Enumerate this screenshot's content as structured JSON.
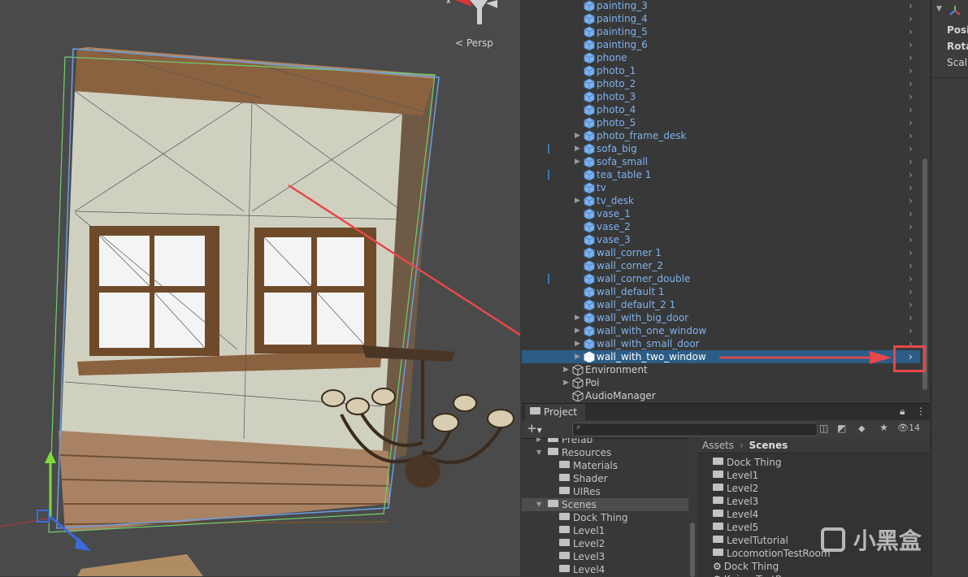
{
  "scene": {
    "persp_label": "Persp",
    "gizmo_axis_label": "x"
  },
  "hierarchy": {
    "items": [
      {
        "label": "painting_3",
        "kind": "cube",
        "arrow": false
      },
      {
        "label": "painting_4",
        "kind": "cube",
        "arrow": false
      },
      {
        "label": "painting_5",
        "kind": "cube",
        "arrow": false
      },
      {
        "label": "painting_6",
        "kind": "cube",
        "arrow": false
      },
      {
        "label": "phone",
        "kind": "cube",
        "arrow": false
      },
      {
        "label": "photo_1",
        "kind": "cube",
        "arrow": false
      },
      {
        "label": "photo_2",
        "kind": "cube",
        "arrow": false
      },
      {
        "label": "photo_3",
        "kind": "cube",
        "arrow": false
      },
      {
        "label": "photo_4",
        "kind": "cube",
        "arrow": false
      },
      {
        "label": "photo_5",
        "kind": "cube",
        "arrow": false
      },
      {
        "label": "photo_frame_desk",
        "kind": "cube",
        "arrow": true
      },
      {
        "label": "sofa_big",
        "kind": "cube",
        "arrow": true
      },
      {
        "label": "sofa_small",
        "kind": "cube",
        "arrow": true
      },
      {
        "label": "tea_table 1",
        "kind": "cube",
        "arrow": false
      },
      {
        "label": "tv",
        "kind": "cube",
        "arrow": false
      },
      {
        "label": "tv_desk",
        "kind": "cube",
        "arrow": true
      },
      {
        "label": "vase_1",
        "kind": "cube",
        "arrow": false
      },
      {
        "label": "vase_2",
        "kind": "cube",
        "arrow": false
      },
      {
        "label": "vase_3",
        "kind": "cube",
        "arrow": false
      },
      {
        "label": "wall_corner 1",
        "kind": "cube",
        "arrow": false
      },
      {
        "label": "wall_corner_2",
        "kind": "cube",
        "arrow": false
      },
      {
        "label": "wall_corner_double",
        "kind": "cube",
        "arrow": false
      },
      {
        "label": "wall_default 1",
        "kind": "cube",
        "arrow": false
      },
      {
        "label": "wall_default_2 1",
        "kind": "cube",
        "arrow": false
      },
      {
        "label": "wall_with_big_door",
        "kind": "cube",
        "arrow": true
      },
      {
        "label": "wall_with_one_window",
        "kind": "cube",
        "arrow": true
      },
      {
        "label": "wall_with_small_door",
        "kind": "cube",
        "arrow": true
      },
      {
        "label": "wall_with_two_window",
        "kind": "cube",
        "arrow": true,
        "selected": true
      },
      {
        "label": "Environment",
        "kind": "object",
        "arrow": true,
        "indent": -1
      },
      {
        "label": "Poi",
        "kind": "object",
        "arrow": true,
        "indent": -1
      },
      {
        "label": "AudioManager",
        "kind": "object",
        "arrow": false,
        "indent": -1
      }
    ]
  },
  "inspector": {
    "position_label": "Posit",
    "rotation_label": "Rota",
    "scale_label": "Scal"
  },
  "project": {
    "tab_label": "Project",
    "hidden_count": "14",
    "breadcrumb": {
      "root": "Assets",
      "current": "Scenes"
    },
    "tree": [
      {
        "label": "Prefab",
        "indent": 1,
        "open": false,
        "partial": true
      },
      {
        "label": "Resources",
        "indent": 1,
        "open": true
      },
      {
        "label": "Materials",
        "indent": 2
      },
      {
        "label": "Shader",
        "indent": 2
      },
      {
        "label": "UIRes",
        "indent": 2
      },
      {
        "label": "Scenes",
        "indent": 1,
        "open": true,
        "selected": true
      },
      {
        "label": "Dock Thing",
        "indent": 2
      },
      {
        "label": "Level1",
        "indent": 2
      },
      {
        "label": "Level2",
        "indent": 2
      },
      {
        "label": "Level3",
        "indent": 2
      },
      {
        "label": "Level4",
        "indent": 2
      }
    ],
    "contents": [
      {
        "label": "Dock Thing",
        "kind": "folder"
      },
      {
        "label": "Level1",
        "kind": "folder"
      },
      {
        "label": "Level2",
        "kind": "folder"
      },
      {
        "label": "Level3",
        "kind": "folder"
      },
      {
        "label": "Level4",
        "kind": "folder"
      },
      {
        "label": "Level5",
        "kind": "folder"
      },
      {
        "label": "LevelTutorial",
        "kind": "folder"
      },
      {
        "label": "LocomotionTestRoom",
        "kind": "folder"
      },
      {
        "label": "Dock Thing",
        "kind": "scene"
      },
      {
        "label": "KnivesTestRoom",
        "kind": "scene"
      }
    ]
  },
  "watermark": {
    "text": "小黑盒"
  },
  "colors": {
    "selection": "#2c5d87",
    "annotation_red": "#e8474a",
    "prefab_blue": "#7fb2ef"
  }
}
